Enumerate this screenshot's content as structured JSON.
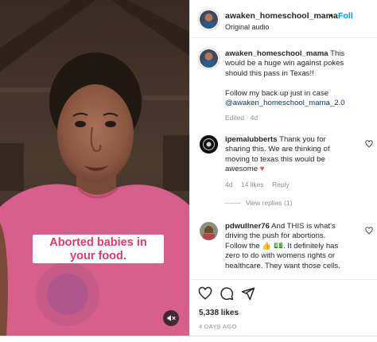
{
  "colors": {
    "follow_blue": "#0095f6",
    "link_blue": "#00376b",
    "caption_pink": "#e2386e",
    "heart_red": "#ed4956",
    "muted_gray": "#8e8e8e"
  },
  "video": {
    "caption_line1": "Aborted babies in",
    "caption_line2": "your food.",
    "mute_icon": "speaker-muted-icon"
  },
  "header": {
    "username": "awaken_homeschool_mama",
    "separator": "•",
    "follow_label": "Foll",
    "audio_label": "Original audio"
  },
  "post_caption": {
    "username": "awaken_homeschool_mama",
    "text_line1": "This",
    "text_line2": "would be a huge win against pokes",
    "text_line3": "should this pass in Texas!!",
    "text_line4": "Follow my back up just in case",
    "mention": "@awaken_homeschool_mama_2.0",
    "meta": "Edited · 4d"
  },
  "comments": [
    {
      "username": "ipemalubberts",
      "line1": "Thank you for",
      "line2": "sharing this. We are thinking of",
      "line3": "moving to texas this would be",
      "line4": "awesome",
      "age": "4d",
      "likes": "14 likes",
      "reply_label": "Reply",
      "view_replies": "View replies (1)"
    },
    {
      "username": "pdwullner76",
      "line1": "And THIS is what's",
      "line2": "driving the push for abortions.",
      "line3a": "Follow the",
      "emoji": "👍 💵",
      "line3b": ". It definitely has",
      "line4": "zero to do with womens rights or",
      "line5": "healthcare. They want those cells."
    }
  ],
  "actions": {
    "icons": [
      "heart-icon",
      "comment-icon",
      "share-icon"
    ],
    "likes": "5,338 likes",
    "date": "4 DAYS AGO"
  }
}
